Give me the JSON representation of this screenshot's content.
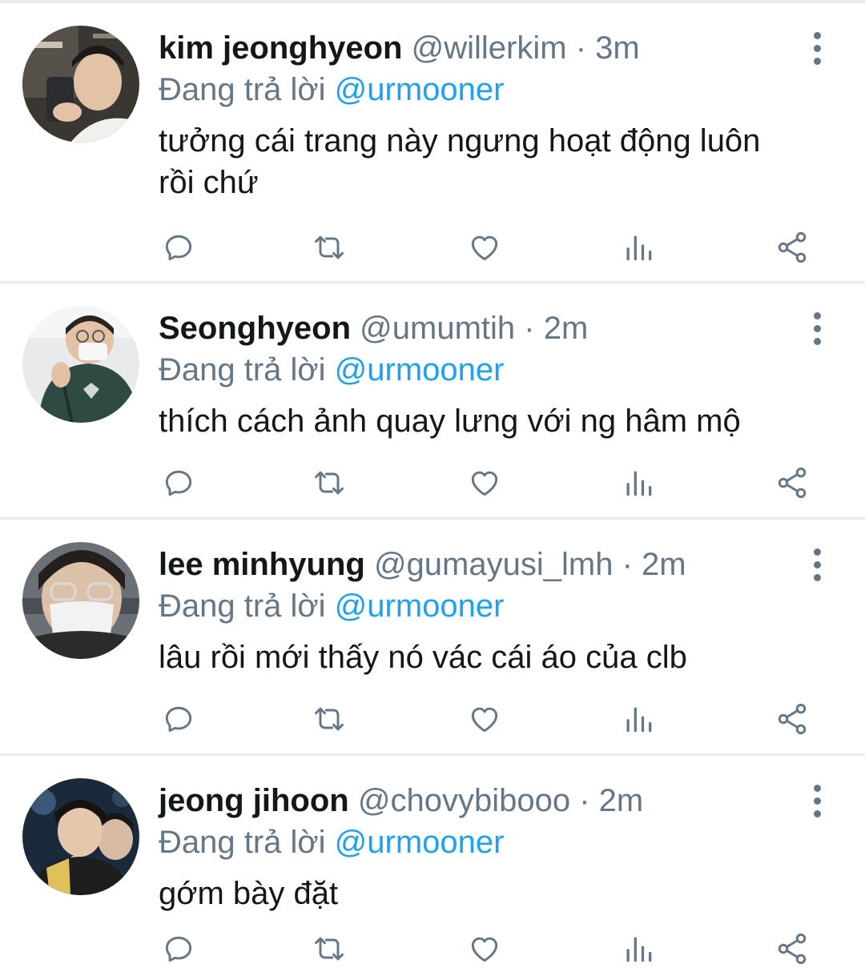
{
  "reply_prefix": "Đang trả lời",
  "tweets": [
    {
      "display_name": "kim jeonghyeon",
      "handle": "@willerkim",
      "time": "3m",
      "reply_to": "@urmooner",
      "text_lines": [
        "tưởng cái trang này ngưng hoạt động luôn",
        "rồi chứ"
      ]
    },
    {
      "display_name": "Seonghyeon",
      "handle": "@umumtih",
      "time": "2m",
      "reply_to": "@urmooner",
      "text_lines": [
        "thích cách ảnh quay lưng với ng hâm mộ"
      ]
    },
    {
      "display_name": "lee minhyung",
      "handle": "@gumayusi_lmh",
      "time": "2m",
      "reply_to": "@urmooner",
      "text_lines": [
        "lâu rồi mới thấy nó vác cái áo của clb"
      ]
    },
    {
      "display_name": "jeong jihoon",
      "handle": "@chovybibooo",
      "time": "2m",
      "reply_to": "@urmooner",
      "text_lines": [
        "gớm bày đặt"
      ]
    }
  ],
  "separator": "·",
  "icons": [
    "reply-icon",
    "retweet-icon",
    "like-icon",
    "stats-icon",
    "share-icon",
    "more-options-icon"
  ],
  "colors": {
    "link": "#1da1f2",
    "muted": "#657786",
    "text": "#14171a",
    "divider": "#e6ecf0"
  }
}
